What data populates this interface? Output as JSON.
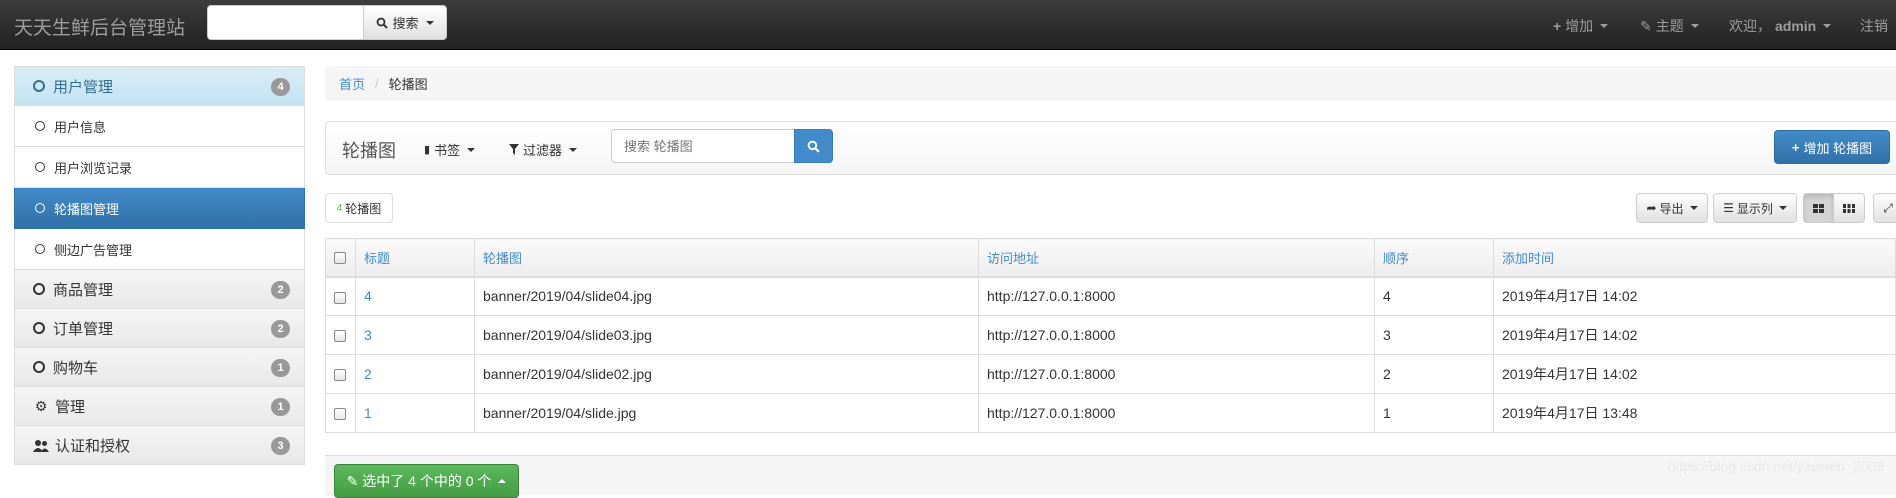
{
  "navbar": {
    "brand": "天天生鲜后台管理站",
    "search_placeholder": "",
    "search_button": "搜索",
    "add_label": "增加",
    "theme_label": "主题",
    "welcome_label": "欢迎，",
    "user": "admin",
    "logout_label": "注销"
  },
  "sidebar": {
    "groups": [
      {
        "label": "用户管理",
        "badge": "4"
      },
      {
        "label": "商品管理",
        "badge": "2"
      },
      {
        "label": "订单管理",
        "badge": "2"
      },
      {
        "label": "购物车",
        "badge": "1"
      },
      {
        "label": "管理",
        "badge": "1"
      },
      {
        "label": "认证和授权",
        "badge": "3"
      }
    ],
    "sub_items": [
      {
        "label": "用户信息"
      },
      {
        "label": "用户浏览记录"
      },
      {
        "label": "轮播图管理"
      },
      {
        "label": "侧边广告管理"
      }
    ]
  },
  "breadcrumb": {
    "home": "首页",
    "current": "轮播图"
  },
  "toolbar": {
    "title": "轮播图",
    "bookmarks_label": "书签",
    "filters_label": "过滤器",
    "search_placeholder": "搜索 轮播图",
    "add_button": "增加 轮播图"
  },
  "list_meta": {
    "count": "4",
    "count_label": "轮播图",
    "export_label": "导出",
    "columns_label": "显示列"
  },
  "table": {
    "headers": [
      "标题",
      "轮播图",
      "访问地址",
      "顺序",
      "添加时间"
    ],
    "rows": [
      {
        "title": "4",
        "image": "banner/2019/04/slide04.jpg",
        "url": "http://127.0.0.1:8000",
        "order": "4",
        "added": "2019年4月17日 14:02"
      },
      {
        "title": "3",
        "image": "banner/2019/04/slide03.jpg",
        "url": "http://127.0.0.1:8000",
        "order": "3",
        "added": "2019年4月17日 14:02"
      },
      {
        "title": "2",
        "image": "banner/2019/04/slide02.jpg",
        "url": "http://127.0.0.1:8000",
        "order": "2",
        "added": "2019年4月17日 14:02"
      },
      {
        "title": "1",
        "image": "banner/2019/04/slide.jpg",
        "url": "http://127.0.0.1:8000",
        "order": "1",
        "added": "2019年4月17日 13:48"
      }
    ]
  },
  "bulk": {
    "label": "选中了 4 个中的 0 个"
  },
  "watermark": "https://blog.csdn.net/yaowen_2008",
  "colors": {
    "primary": "#428bca",
    "success": "#5cb85c",
    "navbar": "#222222",
    "badge": "#999999"
  }
}
